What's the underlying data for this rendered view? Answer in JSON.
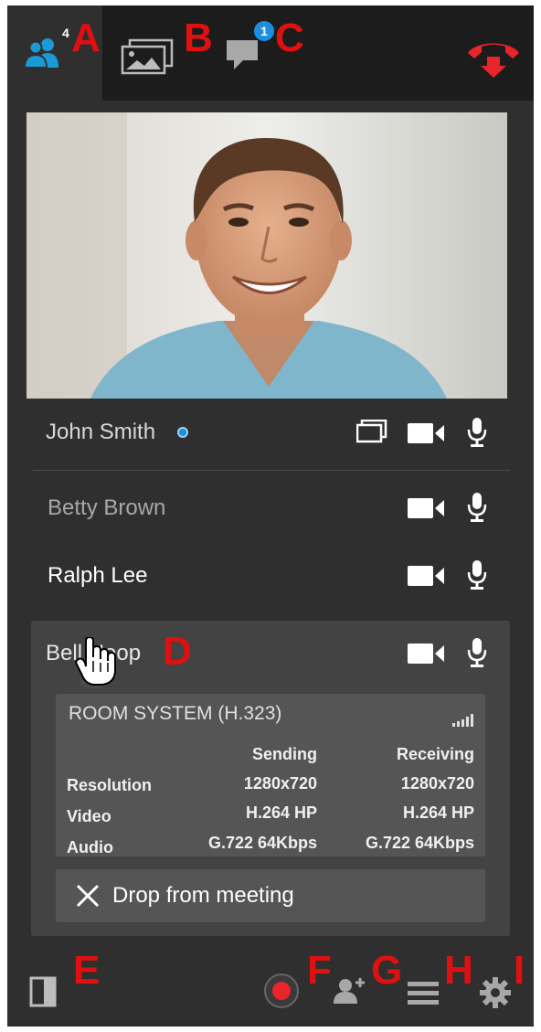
{
  "header": {
    "participants_count": "4",
    "chat_unread": "1",
    "callouts": {
      "a": "A",
      "b": "B",
      "c": "C"
    }
  },
  "participants": [
    {
      "name": "John Smith",
      "icons": [
        "share-screen-icon",
        "camera-icon",
        "microphone-icon"
      ]
    },
    {
      "name": "Betty Brown",
      "icons": [
        "camera-icon",
        "microphone-icon"
      ]
    },
    {
      "name": "Ralph Lee",
      "icons": [
        "camera-icon",
        "microphone-icon"
      ]
    },
    {
      "name": "Bell Hoop",
      "icons": [
        "camera-icon",
        "microphone-icon"
      ]
    }
  ],
  "callout_d": "D",
  "room_system": {
    "title": "ROOM SYSTEM (H.323)",
    "col_sending": "Sending",
    "col_receiving": "Receiving",
    "rows": [
      {
        "label": "Resolution",
        "sending": "1280x720",
        "receiving": "1280x720"
      },
      {
        "label": "Video",
        "sending": "H.264 HP",
        "receiving": "H.264 HP"
      },
      {
        "label": "Audio",
        "sending": "G.722 64Kbps",
        "receiving": "G.722 64Kbps"
      }
    ]
  },
  "drop_button": "Drop from meeting",
  "footer": {
    "callouts": {
      "e": "E",
      "f": "F",
      "g": "G",
      "h": "H",
      "i": "I"
    }
  },
  "colors": {
    "accent_red": "#e01010",
    "hangup_red": "#e8262a",
    "badge_blue": "#1e8ee0",
    "panel": "#2f2f2f"
  }
}
